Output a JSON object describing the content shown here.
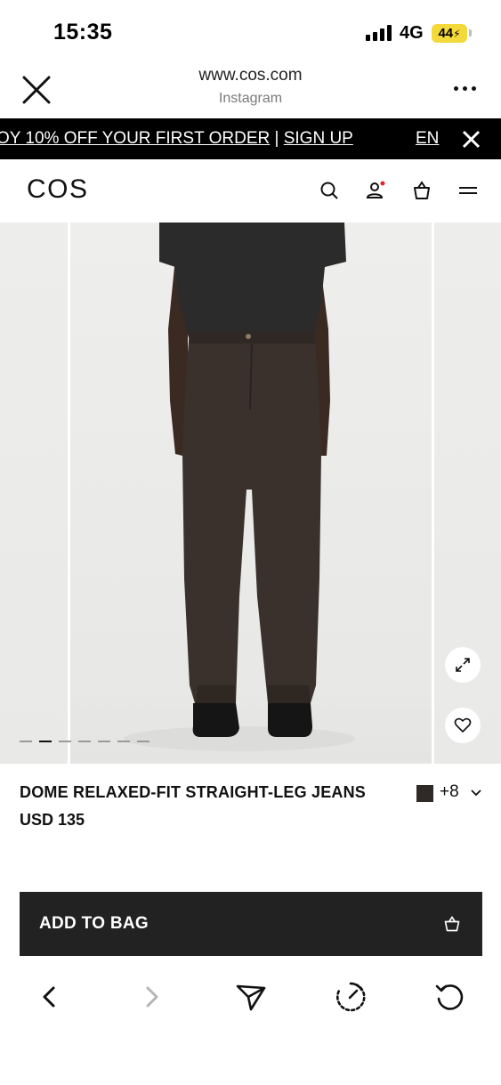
{
  "status_bar": {
    "time": "15:35",
    "network": "4G",
    "battery": "44"
  },
  "browser": {
    "url": "www.cos.com",
    "source": "Instagram",
    "close_icon": "close-icon",
    "more_icon": "more-dots-icon"
  },
  "promo": {
    "text": "OY 10% OFF YOUR FIRST ORDER",
    "separator": " | ",
    "link": "SIGN UP",
    "language": "EN",
    "close_icon": "close-icon"
  },
  "site_header": {
    "logo": "COS",
    "icons": [
      "search-icon",
      "account-icon",
      "bag-icon",
      "menu-icon"
    ],
    "account_notification_color": "#e0262f"
  },
  "gallery": {
    "image_count": 7,
    "active_index": 1,
    "expand_icon": "expand-icon",
    "favorite_icon": "heart-icon"
  },
  "product": {
    "name": "DOME RELAXED-FIT STRAIGHT-LEG JEANS",
    "price": "USD 135",
    "swatch_color": "#2f2a28",
    "more_colors": "+8"
  },
  "cta": {
    "label": "ADD TO BAG",
    "icon": "bag-icon",
    "background": "#222222"
  },
  "bottom_bar": {
    "icons": [
      "back-icon",
      "forward-icon",
      "share-icon",
      "speed-icon",
      "reload-icon"
    ]
  }
}
